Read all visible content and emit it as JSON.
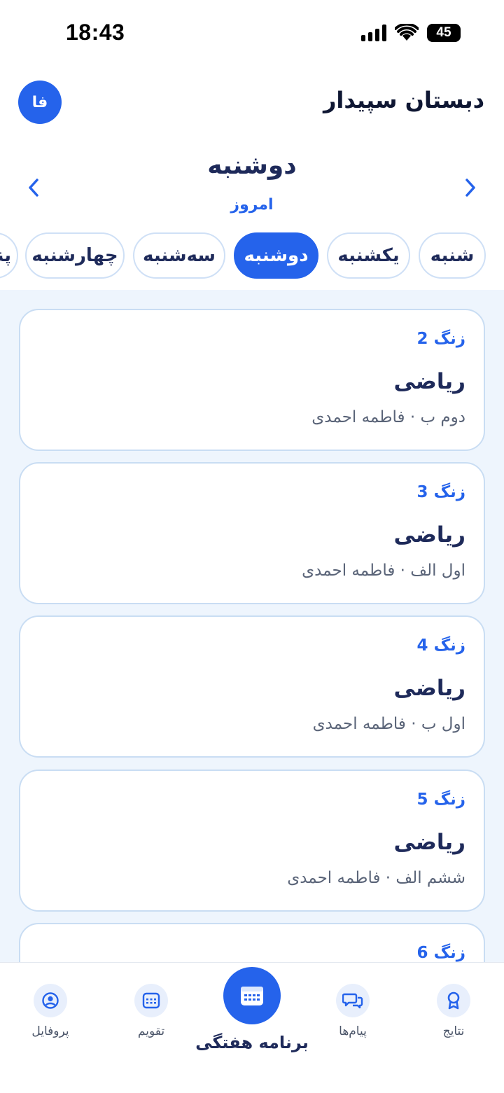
{
  "status_bar": {
    "time": "18:43",
    "battery": "45"
  },
  "header": {
    "school_name": "دبستان سپیدار",
    "lang_button": "فا"
  },
  "day_nav": {
    "title": "دوشنبه",
    "subtitle": "امروز"
  },
  "day_chips": [
    {
      "label": "شنبه",
      "active": false
    },
    {
      "label": "یکشنبه",
      "active": false
    },
    {
      "label": "دوشنبه",
      "active": true
    },
    {
      "label": "سه‌شنبه",
      "active": false
    },
    {
      "label": "چهارشنبه",
      "active": false
    },
    {
      "label": "پنجشنبه",
      "active": false
    }
  ],
  "schedule": [
    {
      "bell": "زنگ 2",
      "subject": "ریاضی",
      "meta": "دوم ب · فاطمه احمدی"
    },
    {
      "bell": "زنگ 3",
      "subject": "ریاضی",
      "meta": "اول الف · فاطمه احمدی"
    },
    {
      "bell": "زنگ 4",
      "subject": "ریاضی",
      "meta": "اول ب · فاطمه احمدی"
    },
    {
      "bell": "زنگ 5",
      "subject": "ریاضی",
      "meta": "ششم الف · فاطمه احمدی"
    },
    {
      "bell": "زنگ 6",
      "subject": "",
      "meta": ""
    }
  ],
  "bottom_nav": {
    "results": "نتایج",
    "messages": "پیام‌ها",
    "weekly": "برنامه هفتگی",
    "calendar": "تقویم",
    "profile": "پروفایل"
  },
  "colors": {
    "accent": "#2563eb",
    "content_bg": "#eef5fd",
    "card_border": "#c9ddf3",
    "title": "#1e2a5a"
  },
  "icons": [
    "signal-icon",
    "wifi-icon",
    "battery-icon",
    "chevron-left-icon",
    "chevron-right-icon",
    "award-icon",
    "chat-icon",
    "calendar-grid-icon",
    "calendar-icon",
    "user-icon"
  ]
}
